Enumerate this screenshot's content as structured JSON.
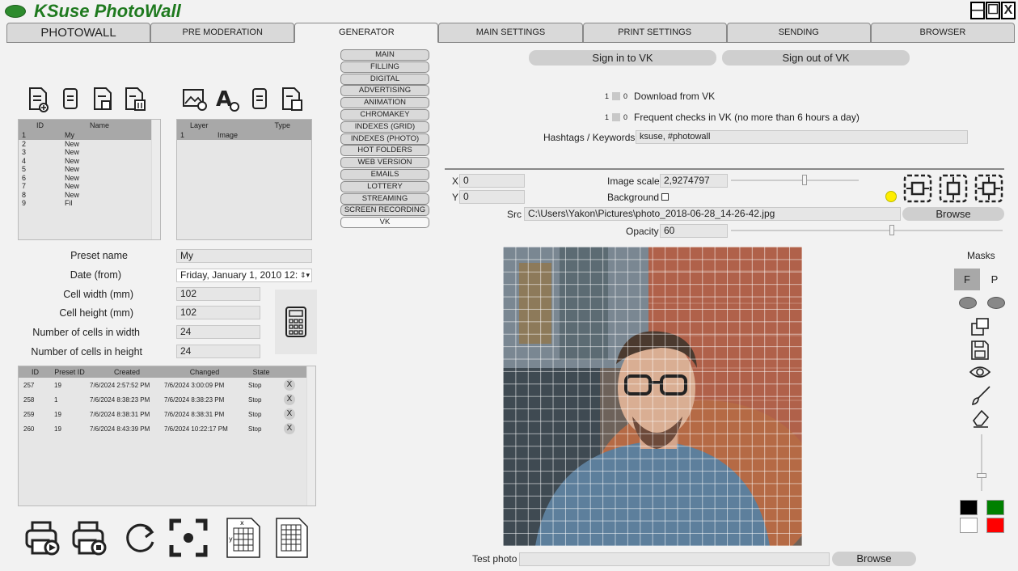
{
  "app": {
    "title": "KSuse PhotoWall"
  },
  "window_buttons": {
    "minimize": "—",
    "maximize": "☐",
    "close": "X"
  },
  "tabs": [
    {
      "label": "PHOTOWALL"
    },
    {
      "label": "PRE MODERATION"
    },
    {
      "label": "GENERATOR"
    },
    {
      "label": "MAIN SETTINGS"
    },
    {
      "label": "PRINT SETTINGS"
    },
    {
      "label": "SENDING"
    },
    {
      "label": "BROWSER"
    }
  ],
  "presets": {
    "columns": [
      "ID",
      "Name"
    ],
    "rows": [
      [
        "1",
        "My"
      ],
      [
        "2",
        "New"
      ],
      [
        "3",
        "New"
      ],
      [
        "4",
        "New"
      ],
      [
        "5",
        "New"
      ],
      [
        "6",
        "New"
      ],
      [
        "7",
        "New"
      ],
      [
        "8",
        "New"
      ],
      [
        "9",
        "Fil"
      ]
    ]
  },
  "layers": {
    "columns": [
      "Layer",
      "Type"
    ],
    "rows": [
      [
        "1",
        "Image"
      ]
    ]
  },
  "form": {
    "preset_name_label": "Preset name",
    "preset_name": "My",
    "date_label": "Date (from)",
    "date": "Friday, January 1, 2010 12:",
    "cell_width_label": "Cell width (mm)",
    "cell_width": "102",
    "cell_height_label": "Cell height (mm)",
    "cell_height": "102",
    "cells_width_label": "Number of cells in width",
    "cells_width": "24",
    "cells_height_label": "Number of cells in height",
    "cells_height": "24"
  },
  "jobs": {
    "columns": [
      "ID",
      "Preset ID",
      "Created",
      "Changed",
      "State"
    ],
    "rows": [
      [
        "257",
        "19",
        "7/6/2024 2:57:52 PM",
        "7/6/2024 3:00:09 PM",
        "Stop"
      ],
      [
        "258",
        "1",
        "7/6/2024 8:38:23 PM",
        "7/6/2024 8:38:23 PM",
        "Stop"
      ],
      [
        "259",
        "19",
        "7/6/2024 8:38:31 PM",
        "7/6/2024 8:38:31 PM",
        "Stop"
      ],
      [
        "260",
        "19",
        "7/6/2024 8:43:39 PM",
        "7/6/2024 10:22:17 PM",
        "Stop"
      ]
    ],
    "delete_label": "X"
  },
  "submenu": [
    "MAIN",
    "FILLING",
    "DIGITAL",
    "ADVERTISING",
    "ANIMATION",
    "CHROMAKEY",
    "INDEXES (GRID)",
    "INDEXES (PHOTO)",
    "HOT FOLDERS",
    "WEB VERSION",
    "EMAILS",
    "LOTTERY",
    "STREAMING",
    "SCREEN RECORDING",
    "VK"
  ],
  "vk": {
    "sign_in": "Sign in to VK",
    "sign_out": "Sign out of VK",
    "download_left": "1",
    "download_right": "0",
    "download_label": "Download from VK",
    "frequent_left": "1",
    "frequent_right": "0",
    "frequent_label": "Frequent checks in VK (no more than 6 hours a day)",
    "hashtags_label": "Hashtags / Keywords",
    "hashtags": "ksuse, #photowall"
  },
  "layer_props": {
    "x_label": "X",
    "x": "0",
    "y_label": "Y",
    "y": "0",
    "scale_label": "Image scale",
    "scale": "2,9274797",
    "background_label": "Background",
    "src_label": "Src",
    "src": "C:\\Users\\Yakon\\Pictures\\photo_2018-06-28_14-26-42.jpg",
    "browse": "Browse",
    "opacity_label": "Opacity",
    "opacity": "60"
  },
  "masks": {
    "label": "Masks",
    "f": "F",
    "p": "P"
  },
  "test_photo": {
    "label": "Test photo",
    "browse": "Browse"
  },
  "colors": {
    "accent_green": "#2e8b2e",
    "swatch_black": "#000000",
    "swatch_green": "#008000",
    "swatch_white": "#ffffff",
    "swatch_red": "#ff0000",
    "indicator": "#ffee00"
  }
}
